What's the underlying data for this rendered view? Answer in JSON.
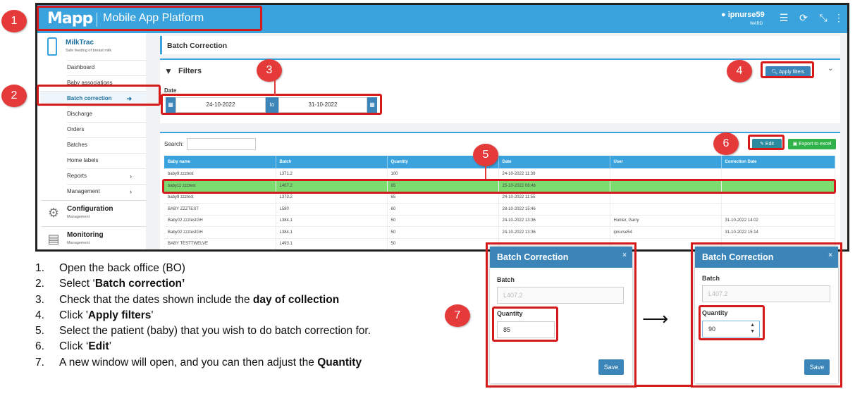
{
  "app": {
    "logo": "Mapp",
    "platform": "Mobile App Platform",
    "user": "ipnurse59",
    "user_role": "WARD"
  },
  "sidebar": {
    "app_name": "MilkTrac",
    "app_sub": "Safe feeding of breast milk",
    "items": [
      {
        "label": "Dashboard"
      },
      {
        "label": "Baby associations"
      },
      {
        "label": "Batch correction"
      },
      {
        "label": "Discharge"
      },
      {
        "label": "Orders"
      },
      {
        "label": "Batches"
      },
      {
        "label": "Home labels"
      },
      {
        "label": "Reports"
      },
      {
        "label": "Management"
      }
    ],
    "sections": [
      {
        "title": "Configuration",
        "sub": "Management"
      },
      {
        "title": "Monitoring",
        "sub": "Management"
      }
    ]
  },
  "page": {
    "title": "Batch Correction",
    "filters_title": "Filters",
    "apply_filters": "Apply filters",
    "date_label": "Date",
    "date_from": "24-10-2022",
    "date_to_label": "to",
    "date_to": "31-10-2022",
    "search_label": "Search:",
    "edit": "Edit",
    "export": "Export to excel"
  },
  "table": {
    "headers": [
      "Baby name",
      "Batch",
      "Quantity",
      "Date",
      "User",
      "Correction Date"
    ],
    "rows": [
      [
        "baby9 zzztest",
        "L371.2",
        "100",
        "24-10-2022 11:39",
        "",
        ""
      ],
      [
        "baby11 zzztest",
        "L407.2",
        "85",
        "25-10-2022 08:48",
        "",
        ""
      ],
      [
        "baby9 zzztest",
        "L373.2",
        "65",
        "24-10-2022 11:55",
        "",
        ""
      ],
      [
        "BABY ZZZTEST",
        "L580",
        "60",
        "28-10-2022 15:46",
        "",
        ""
      ],
      [
        "Baby02 zzztestGH",
        "L384.1",
        "50",
        "24-10-2022 13:36",
        "Hunter, Garry",
        "31-10-2022 14:02"
      ],
      [
        "Baby02 zzztestGH",
        "L384.1",
        "50",
        "24-10-2022 13:36",
        "ipnurse54",
        "31-10-2022 15:14"
      ],
      [
        "BABY TESTTWELVE",
        "L493.1",
        "50",
        "",
        "",
        ""
      ]
    ]
  },
  "badges": [
    "1",
    "2",
    "3",
    "4",
    "5",
    "6",
    "7"
  ],
  "steps": [
    {
      "n": "1.",
      "parts": [
        {
          "t": "Open the back office (BO)",
          "b": false
        }
      ]
    },
    {
      "n": "2.",
      "parts": [
        {
          "t": "Select ‘",
          "b": false
        },
        {
          "t": "Batch correction’",
          "b": true
        }
      ]
    },
    {
      "n": "3.",
      "parts": [
        {
          "t": "Check that the dates shown include the ",
          "b": false
        },
        {
          "t": "day of collection",
          "b": true
        }
      ]
    },
    {
      "n": "4.",
      "parts": [
        {
          "t": "Click '",
          "b": false
        },
        {
          "t": "Apply filters",
          "b": true
        },
        {
          "t": "'",
          "b": false
        }
      ]
    },
    {
      "n": "5.",
      "parts": [
        {
          "t": "Select the patient (baby) that you wish to do batch correction for.",
          "b": false
        }
      ]
    },
    {
      "n": "6.",
      "parts": [
        {
          "t": "Click ‘",
          "b": false
        },
        {
          "t": "Edit",
          "b": true
        },
        {
          "t": "’",
          "b": false
        }
      ]
    },
    {
      "n": "7.",
      "parts": [
        {
          "t": "A new window will open, and you can then adjust the ",
          "b": false
        },
        {
          "t": "Quantity",
          "b": true
        }
      ]
    }
  ],
  "dialog_before": {
    "title": "Batch Correction",
    "close": "×",
    "batch_label": "Batch",
    "batch_value": "L407.2",
    "quantity_label": "Quantity",
    "quantity_value": "85",
    "save": "Save"
  },
  "dialog_after": {
    "title": "Batch Correction",
    "close": "×",
    "batch_label": "Batch",
    "batch_value": "L407.2",
    "quantity_label": "Quantity",
    "quantity_value": "90",
    "save": "Save"
  },
  "arrow": "⟶",
  "colors": {
    "primary": "#3aa3dd",
    "dark_blue": "#3b85b8",
    "annotation_red": "#d61a1a",
    "highlight_green": "#7ddc6f",
    "export_green": "#2fb34a"
  }
}
